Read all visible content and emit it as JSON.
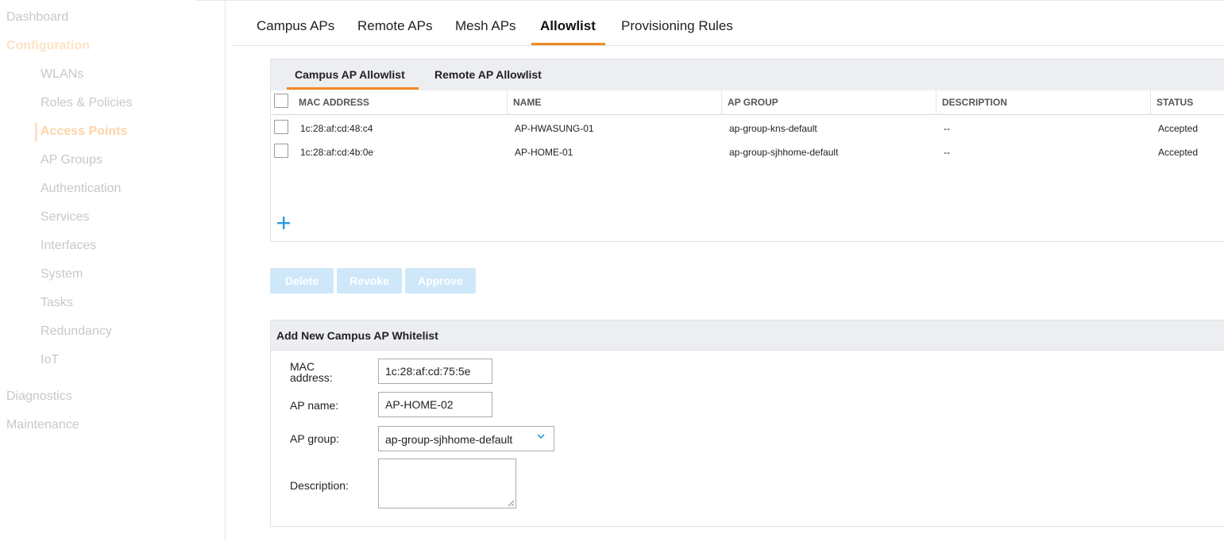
{
  "sidebar": {
    "dashboard": "Dashboard",
    "configuration": "Configuration",
    "items": [
      "WLANs",
      "Roles & Policies",
      "Access Points",
      "AP Groups",
      "Authentication",
      "Services",
      "Interfaces",
      "System",
      "Tasks",
      "Redundancy",
      "IoT"
    ],
    "active_item": "Access Points",
    "diagnostics": "Diagnostics",
    "maintenance": "Maintenance"
  },
  "tabs": [
    "Campus APs",
    "Remote APs",
    "Mesh APs",
    "Allowlist",
    "Provisioning Rules"
  ],
  "active_tab": "Allowlist",
  "subtabs": [
    "Campus AP Allowlist",
    "Remote AP Allowlist"
  ],
  "active_subtab": "Campus AP Allowlist",
  "table": {
    "columns": [
      "MAC ADDRESS",
      "NAME",
      "AP GROUP",
      "DESCRIPTION",
      "STATUS"
    ],
    "rows": [
      [
        "1c:28:af:cd:48:c4",
        "AP-HWASUNG-01",
        "ap-group-kns-default",
        "--",
        "Accepted"
      ],
      [
        "1c:28:af:cd:4b:0e",
        "AP-HOME-01",
        "ap-group-sjhhome-default",
        "--",
        "Accepted"
      ]
    ]
  },
  "add_icon": "plus-icon",
  "actions": {
    "delete": "Delete",
    "revoke": "Revoke",
    "approve": "Approve"
  },
  "form": {
    "title": "Add New Campus AP Whitelist",
    "mac_label": "MAC address:",
    "mac_value": "1c:28:af:cd:75:5e",
    "name_label": "AP name:",
    "name_value": "AP-HOME-02",
    "group_label": "AP group:",
    "group_value": "ap-group-sjhhome-default",
    "description_label": "Description:",
    "description_value": ""
  },
  "colors": {
    "accent": "#f08a24",
    "link": "#2f9be0",
    "disabled_button": "#cfe8f9",
    "header_bg": "#eceef1"
  }
}
